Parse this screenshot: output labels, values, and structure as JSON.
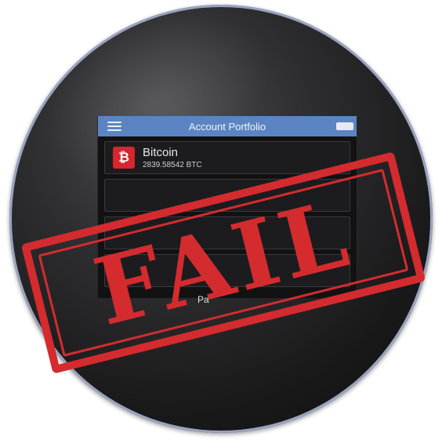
{
  "app": {
    "title": "Account Portfolio",
    "menu_icon": "hamburger-menu-icon",
    "card_icon": "card-icon"
  },
  "portfolio": {
    "items": [
      {
        "name": "Bitcoin",
        "amount": "2839.58542 BTC",
        "icon_symbol": "₿",
        "icon_color": "#d7262e"
      },
      {
        "name": "",
        "amount": ""
      },
      {
        "name": "",
        "amount": ""
      },
      {
        "name": "",
        "amount": ""
      }
    ]
  },
  "footer": {
    "partial_text": "Pa"
  },
  "stamp": {
    "text": "FAIL",
    "color": "#d42b2f"
  },
  "colors": {
    "titlebar": "#5b85c2",
    "background": "#121213",
    "accent_red": "#d42b2f"
  }
}
